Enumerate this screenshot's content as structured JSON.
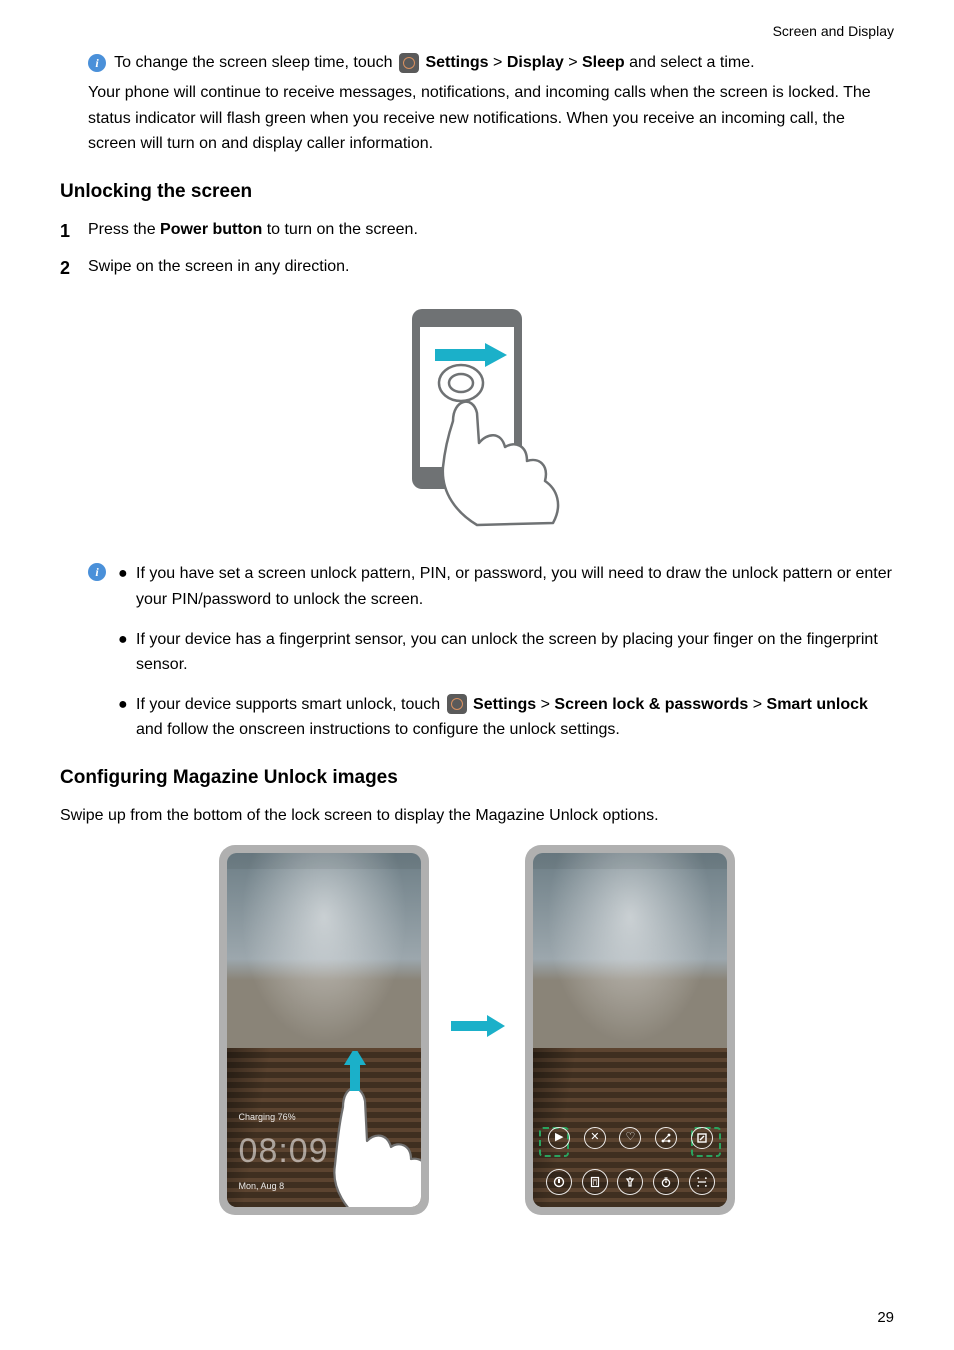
{
  "header": {
    "section": "Screen and Display"
  },
  "tip1": {
    "pre": "To change the screen sleep time, touch ",
    "settings": "Settings",
    "display": "Display",
    "sleep": "Sleep",
    "post": " and select a time."
  },
  "para1": "Your phone will continue to receive messages, notifications, and incoming calls when the screen is locked. The status indicator will flash green when you receive new notifications. When you receive an incoming call, the screen will turn on and display caller information.",
  "sec1": {
    "title": "Unlocking the screen",
    "step1_pre": "Press the ",
    "step1_bold": "Power button",
    "step1_post": " to turn on the screen.",
    "step2": "Swipe on the screen in any direction."
  },
  "bullets": {
    "b1": "If you have set a screen unlock pattern, PIN, or password, you will need to draw the unlock pattern or enter your PIN/password to unlock the screen.",
    "b2": "If your device has a fingerprint sensor, you can unlock the screen by placing your finger on the fingerprint sensor.",
    "b3_pre": "If your device supports smart unlock, touch ",
    "b3_settings": "Settings",
    "b3_path": "Screen lock & passwords",
    "b3_smart": "Smart unlock",
    "b3_post": " and follow the onscreen instructions to configure the unlock settings."
  },
  "sec2": {
    "title": "Configuring Magazine Unlock images",
    "body": "Swipe up from the bottom of the lock screen to display the Magazine Unlock options."
  },
  "lockscreen": {
    "charging": "Charging 76%",
    "time": "08:09",
    "date": "Mon, Aug 8"
  },
  "pageNumber": "29",
  "gt": ">"
}
